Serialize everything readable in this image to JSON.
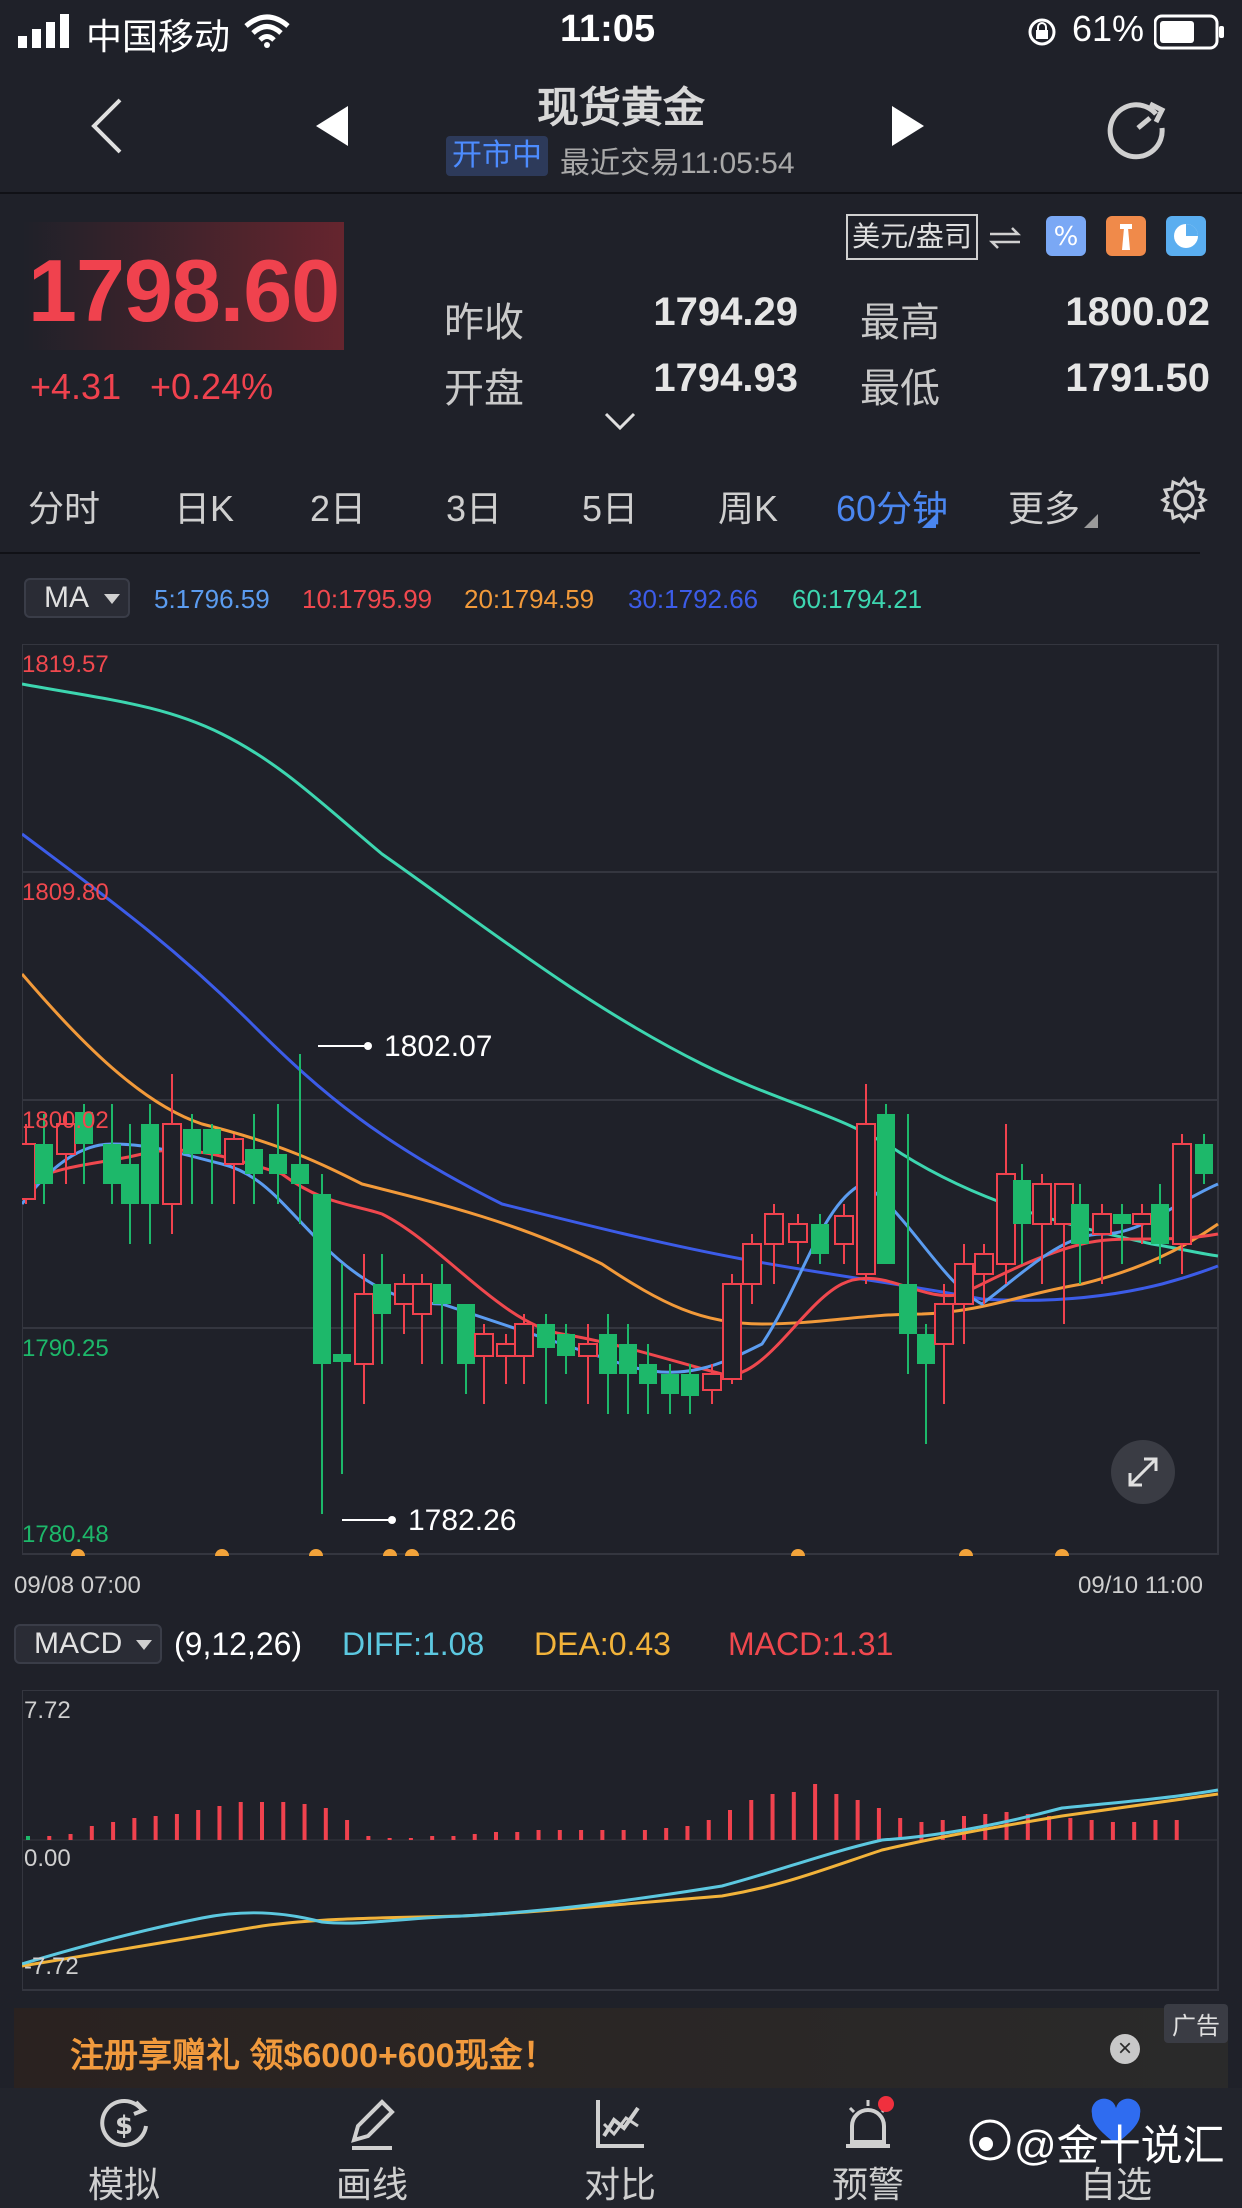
{
  "status_bar": {
    "carrier": "中国移动",
    "time": "11:05",
    "battery": "61%"
  },
  "nav": {
    "title": "现货黄金",
    "market_status": "开市中",
    "last_trade": "最近交易11:05:54"
  },
  "quote": {
    "price": "1798.60",
    "change": "+4.31",
    "change_pct": "+0.24%",
    "unit": "美元/盎司",
    "prev_close_label": "昨收",
    "prev_close": "1794.29",
    "open_label": "开盘",
    "open": "1794.93",
    "high_label": "最高",
    "high": "1800.02",
    "low_label": "最低",
    "low": "1791.50"
  },
  "tabs": [
    {
      "label": "分时"
    },
    {
      "label": "日K"
    },
    {
      "label": "2日"
    },
    {
      "label": "3日"
    },
    {
      "label": "5日"
    },
    {
      "label": "周K"
    },
    {
      "label": "60分钟",
      "active": true
    },
    {
      "label": "更多"
    }
  ],
  "indicators": {
    "ma_select": "MA",
    "ma": [
      {
        "text": "5:1796.59",
        "color": "#5b9cf0"
      },
      {
        "text": "10:1795.99",
        "color": "#f0484e"
      },
      {
        "text": "20:1794.59",
        "color": "#f29a3a"
      },
      {
        "text": "30:1792.66",
        "color": "#3c5ce8"
      },
      {
        "text": "60:1794.21",
        "color": "#3dd6b0"
      }
    ],
    "macd_select": "MACD",
    "macd_params": "(9,12,26)",
    "diff": "DIFF:1.08",
    "dea": "DEA:0.43",
    "macd": "MACD:1.31"
  },
  "chart": {
    "y_labels": [
      "1819.57",
      "1809.80",
      "1800.02",
      "1790.25",
      "1780.48"
    ],
    "annotation_high": "1802.07",
    "annotation_low": "1782.26",
    "date_start": "09/08 07:00",
    "date_end": "09/10 11:00",
    "macd_labels": [
      "7.72",
      "0.00",
      "-7.72"
    ]
  },
  "ad": {
    "text": "注册享赠礼 领$6000+600现金！",
    "tag": "广告",
    "close": "×"
  },
  "toolbar": [
    {
      "label": "模拟",
      "icon": "dollar-cycle-icon"
    },
    {
      "label": "画线",
      "icon": "pen-icon"
    },
    {
      "label": "对比",
      "icon": "compare-chart-icon"
    },
    {
      "label": "预警",
      "icon": "alarm-icon"
    },
    {
      "label": "自选",
      "icon": "heart-icon"
    }
  ],
  "watermark": "@金十说汇",
  "colors": {
    "up": "#f0424e",
    "down": "#1db86a",
    "accent": "#4a86f0",
    "background": "#1f2129"
  }
}
